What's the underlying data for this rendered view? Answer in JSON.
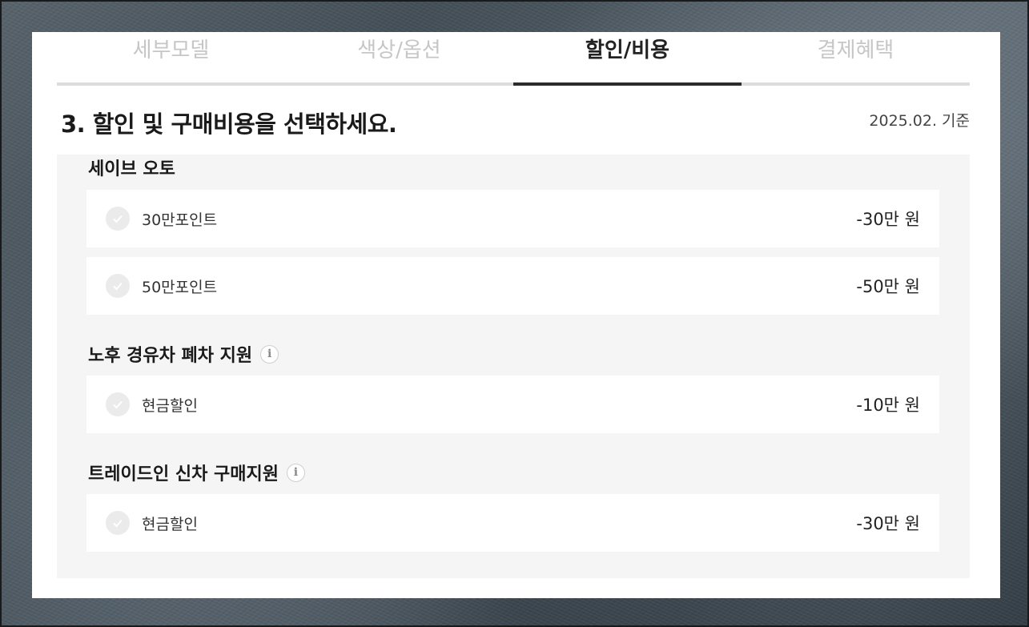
{
  "tabs": [
    {
      "label": "세부모델",
      "active": false
    },
    {
      "label": "색상/옵션",
      "active": false
    },
    {
      "label": "할인/비용",
      "active": true
    },
    {
      "label": "결제혜택",
      "active": false
    }
  ],
  "heading": {
    "title": "3. 할인 및 구매비용을 선택하세요.",
    "date": "2025.02. 기준"
  },
  "sections": [
    {
      "title": "세이브 오토",
      "has_info": false,
      "items": [
        {
          "label": "30만포인트",
          "amount": "-30만 원"
        },
        {
          "label": "50만포인트",
          "amount": "-50만 원"
        }
      ]
    },
    {
      "title": "노후 경유차 폐차 지원",
      "has_info": true,
      "items": [
        {
          "label": "현금할인",
          "amount": "-10만 원"
        }
      ]
    },
    {
      "title": "트레이드인 신차 구매지원",
      "has_info": true,
      "items": [
        {
          "label": "현금할인",
          "amount": "-30만 원"
        }
      ]
    }
  ],
  "icons": {
    "info": "i"
  }
}
